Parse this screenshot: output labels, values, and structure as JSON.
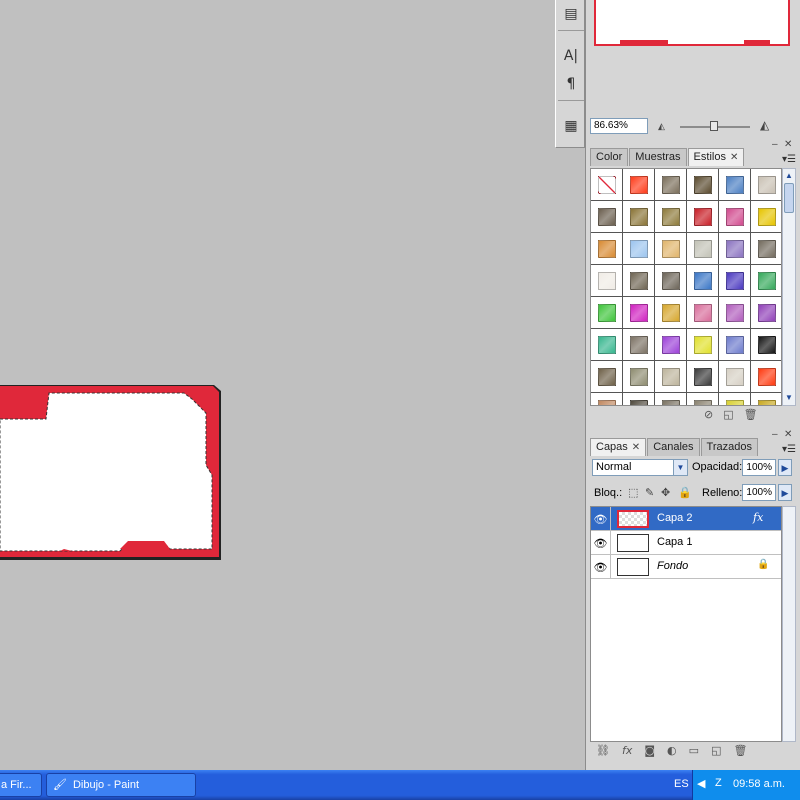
{
  "navigator": {
    "zoom": "86.63%"
  },
  "tools": {
    "items": [
      {
        "name": "tool-presets-icon",
        "glyph": "▤"
      },
      {
        "name": "character-icon",
        "glyph": "A|"
      },
      {
        "name": "paragraph-icon",
        "glyph": "¶"
      },
      {
        "name": "info-panel-icon",
        "glyph": "▦"
      }
    ]
  },
  "styles_panel": {
    "tabs": [
      "Color",
      "Muestras",
      "Estilos"
    ],
    "active_tab": "Estilos",
    "swatches": [
      "#ffffff",
      "#ff3b1a",
      "#7a6e5a",
      "#5a4a2e",
      "#4a7ec2",
      "#c9c1b4",
      "#6a5e4e",
      "#8a7436",
      "#8d7a3a",
      "#c81e26",
      "#d14a8e",
      "#e6c400",
      "#d88a32",
      "#9cc4ee",
      "#e0b46a",
      "#c2c2b6",
      "#8a72c0",
      "#736b5e",
      "#f0ece6",
      "#6e6452",
      "#6c6458",
      "#3a76c6",
      "#4a38c0",
      "#34a85a",
      "#3ec43a",
      "#d020c0",
      "#d6a62c",
      "#d86c9a",
      "#b05cbc",
      "#9040b8",
      "#36b68e",
      "#7c7264",
      "#9c40d8",
      "#e0e02a",
      "#6c7acc",
      "#141414",
      "#6e6048",
      "#8e8c70",
      "#bdb49c",
      "#3a3a3a",
      "#d6d0c4",
      "#ff3a10",
      "#c08860",
      "#504a3e",
      "#7a7262",
      "#8a8270",
      "#d8d030",
      "#c8a820"
    ],
    "footer_icons": [
      "clear-style-icon",
      "new-style-icon",
      "delete-style-icon"
    ]
  },
  "layers_panel": {
    "tabs": [
      "Capas",
      "Canales",
      "Trazados"
    ],
    "active_tab": "Capas",
    "blend_mode": "Normal",
    "opacity_label": "Opacidad:",
    "opacity": "100%",
    "lock_label": "Bloq.:",
    "fill_label": "Relleno:",
    "fill": "100%",
    "layers": [
      {
        "name": "Capa 2",
        "selected": true,
        "fx": "fx",
        "thumb": "checker"
      },
      {
        "name": "Capa 1",
        "selected": false,
        "fx": "",
        "thumb": "shape"
      },
      {
        "name": "Fondo",
        "selected": false,
        "fx": "",
        "thumb": "white",
        "locked": true
      }
    ],
    "footer_icons": [
      "link-layers-icon",
      "add-style-icon",
      "add-mask-icon",
      "adjustment-layer-icon",
      "new-group-icon",
      "new-layer-icon",
      "delete-layer-icon"
    ]
  },
  "taskbar": {
    "tasks": [
      "a Fir...",
      "Dibujo - Paint"
    ],
    "language": "ES",
    "time": "09:58 a.m."
  },
  "colors": {
    "accent_red": "#e0283a",
    "selection_blue": "#316ac5",
    "taskbar_blue": "#245edc"
  }
}
